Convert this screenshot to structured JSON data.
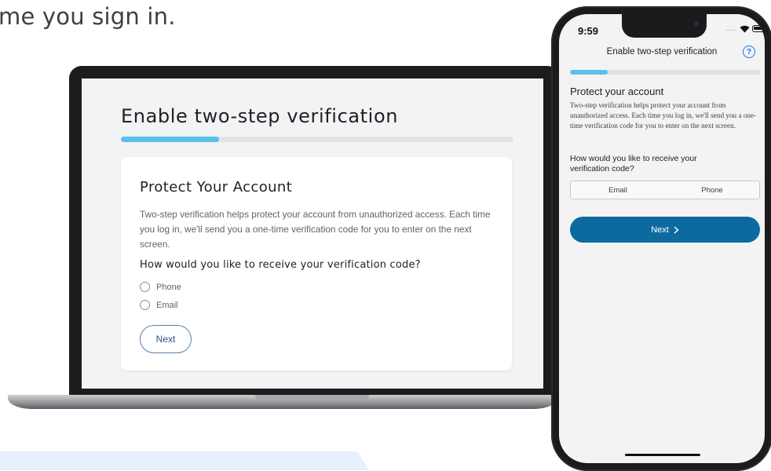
{
  "intro_text": "me you sign in.",
  "colors": {
    "accent": "#5bc0eb",
    "primary_button": "#0d6aa0",
    "help_icon": "#1a73e8"
  },
  "laptop": {
    "title": "Enable two-step verification",
    "progress": 0.25,
    "card": {
      "title": "Protect Your Account",
      "description": "Two-step verification helps protect your account from unauthorized access. Each time you log in, we'll send you a one-time verification code for you to enter on the next screen.",
      "question": "How would you like to receive your verification code?",
      "options": [
        "Phone",
        "Email"
      ],
      "next_label": "Next"
    }
  },
  "phone": {
    "time": "9:59",
    "header_title": "Enable two-step verification",
    "help_icon": "question-circle-icon",
    "progress": 0.2,
    "title": "Protect your account",
    "description": "Two-step verification helps protect your account from unauthorized access. Each time you log in, we'll send you a one-time verification code for you to enter on the next screen.",
    "question": "How would you like to receive your verification code?",
    "segments": [
      "Email",
      "Phone"
    ],
    "next_label": "Next",
    "next_icon": "chevron-right-icon"
  }
}
